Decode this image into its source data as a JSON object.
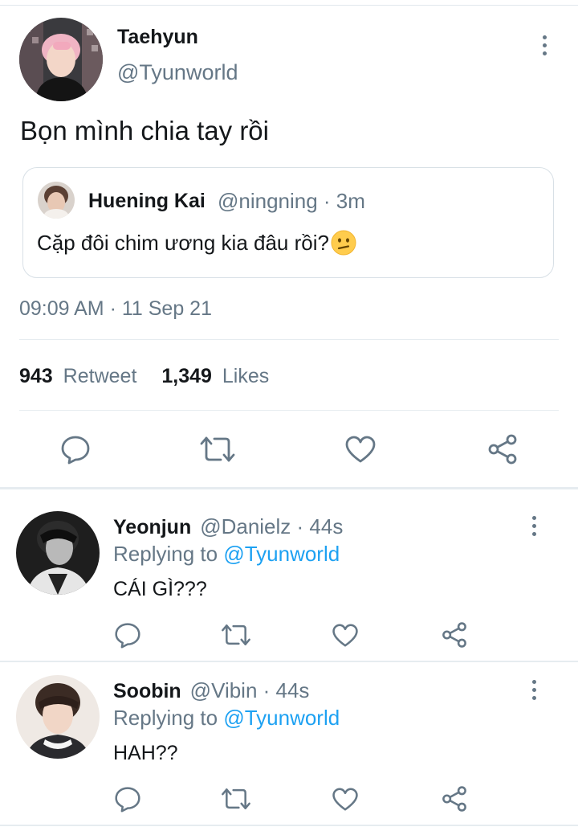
{
  "tweet": {
    "author_name": "Taehyun",
    "author_handle": "@Tyunworld",
    "text": "Bọn mình chia tay rồi",
    "quote": {
      "author_name": "Huening Kai",
      "author_meta": "@ningning · 3m",
      "text": "Cặp đôi chim ương kia đâu rồi? ",
      "emoji": "confused-face"
    },
    "timestamp": "09:09 AM · 11 Sep 21",
    "retweet_count": "943",
    "retweet_label": "Retweet",
    "like_count": "1,349",
    "like_label": "Likes"
  },
  "replies": [
    {
      "author_name": "Yeonjun",
      "author_meta": "@Danielz · 44s",
      "replying_prefix": "Replying to ",
      "replying_handle": "@Tyunworld",
      "text": "CÁI GÌ???"
    },
    {
      "author_name": "Soobin",
      "author_meta": "@Vibin · 44s",
      "replying_prefix": "Replying to ",
      "replying_handle": "@Tyunworld",
      "text": "HAH??"
    }
  ],
  "colors": {
    "link": "#1da1f2",
    "muted": "#657786",
    "text": "#14171a",
    "divider": "#e6ecf0"
  }
}
